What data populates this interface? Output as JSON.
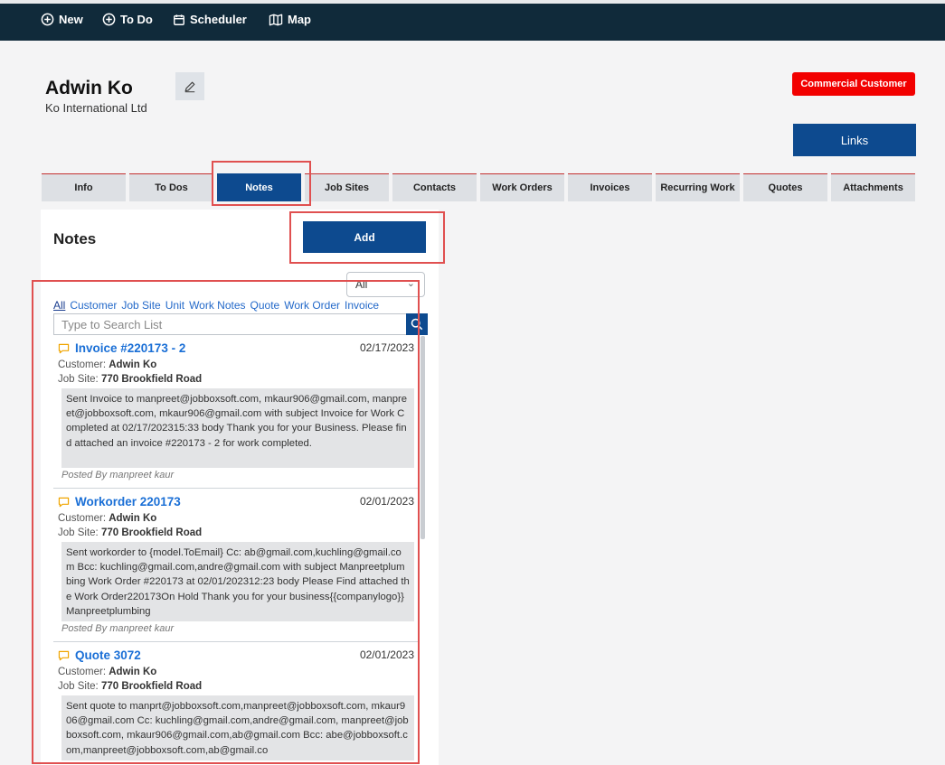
{
  "topnav": {
    "items": [
      {
        "label": "New",
        "icon": "plus-circle-icon"
      },
      {
        "label": "To Do",
        "icon": "plus-circle-icon"
      },
      {
        "label": "Scheduler",
        "icon": "calendar-icon"
      },
      {
        "label": "Map",
        "icon": "map-icon"
      }
    ]
  },
  "customer": {
    "name": "Adwin Ko",
    "company": "Ko International Ltd",
    "badge": "Commercial Customer",
    "links_label": "Links"
  },
  "tabs": [
    "Info",
    "To Dos",
    "Notes",
    "Job Sites",
    "Contacts",
    "Work Orders",
    "Invoices",
    "Recurring Work",
    "Quotes",
    "Attachments"
  ],
  "active_tab": "Notes",
  "notes": {
    "title": "Notes",
    "add_label": "Add",
    "filter_selected": "All",
    "filter_links": [
      "All",
      "Customer",
      "Job Site",
      "Unit",
      "Work Notes",
      "Quote",
      "Work Order",
      "Invoice"
    ],
    "search_placeholder": "Type to Search List",
    "customer_label": "Customer:",
    "site_label": "Job Site:",
    "items": [
      {
        "title": "Invoice #220173 - 2",
        "date": "02/17/2023",
        "customer": "Adwin Ko",
        "site": "770 Brookfield Road",
        "body": "Sent Invoice to manpreet@jobboxsoft.com, mkaur906@gmail.com, manpreet@jobboxsoft.com, mkaur906@gmail.com with subject Invoice for Work Completed at 02/17/202315:33 body Thank you for your Business. Please find attached an invoice #220173 - 2 for work completed.",
        "posted": "Posted By manpreet kaur"
      },
      {
        "title": "Workorder 220173",
        "date": "02/01/2023",
        "customer": "Adwin Ko",
        "site": "770 Brookfield Road",
        "body": "Sent workorder to {model.ToEmail} Cc: ab@gmail.com,kuchling@gmail.com Bcc: kuchling@gmail.com,andre@gmail.com with subject Manpreetplumbing Work Order #220173 at 02/01/202312:23 body Please Find attached the Work Order220173On Hold Thank you for your business{{companylogo}}Manpreetplumbing",
        "posted": "Posted By manpreet kaur"
      },
      {
        "title": "Quote 3072",
        "date": "02/01/2023",
        "customer": "Adwin Ko",
        "site": "770 Brookfield Road",
        "body": "Sent quote to manprt@jobboxsoft.com,manpreet@jobboxsoft.com, mkaur906@gmail.com Cc: kuchling@gmail.com,andre@gmail.com, manpreet@jobboxsoft.com, mkaur906@gmail.com,ab@gmail.com Bcc: abe@jobboxsoft.com,manpreet@jobboxsoft.com,ab@gmail.co",
        "posted": ""
      }
    ]
  }
}
